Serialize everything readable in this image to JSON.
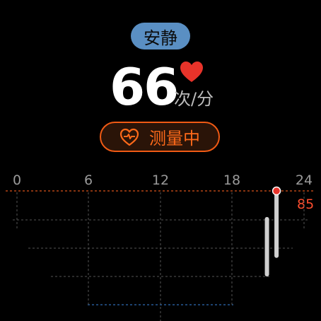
{
  "header": {
    "status_label": "安静",
    "heart_rate_value": "66",
    "heart_rate_unit": "次/分"
  },
  "measure_button": {
    "label": "测量中",
    "icon": "heart-pulse-icon"
  },
  "chart_data": {
    "type": "bar",
    "x_ticks": [
      "0",
      "6",
      "12",
      "18",
      "24"
    ],
    "max_value_label": "85",
    "max_value": 85,
    "bars": [
      {
        "x_hour": 20.9,
        "low": 62,
        "high": 78
      },
      {
        "x_hour": 21.7,
        "low": 67,
        "high": 85
      }
    ]
  },
  "colors": {
    "accent_orange": "#f05a14",
    "status_blue": "#5a8fc3",
    "heart_red": "#e8332a",
    "max_red": "#ff4d2e"
  }
}
